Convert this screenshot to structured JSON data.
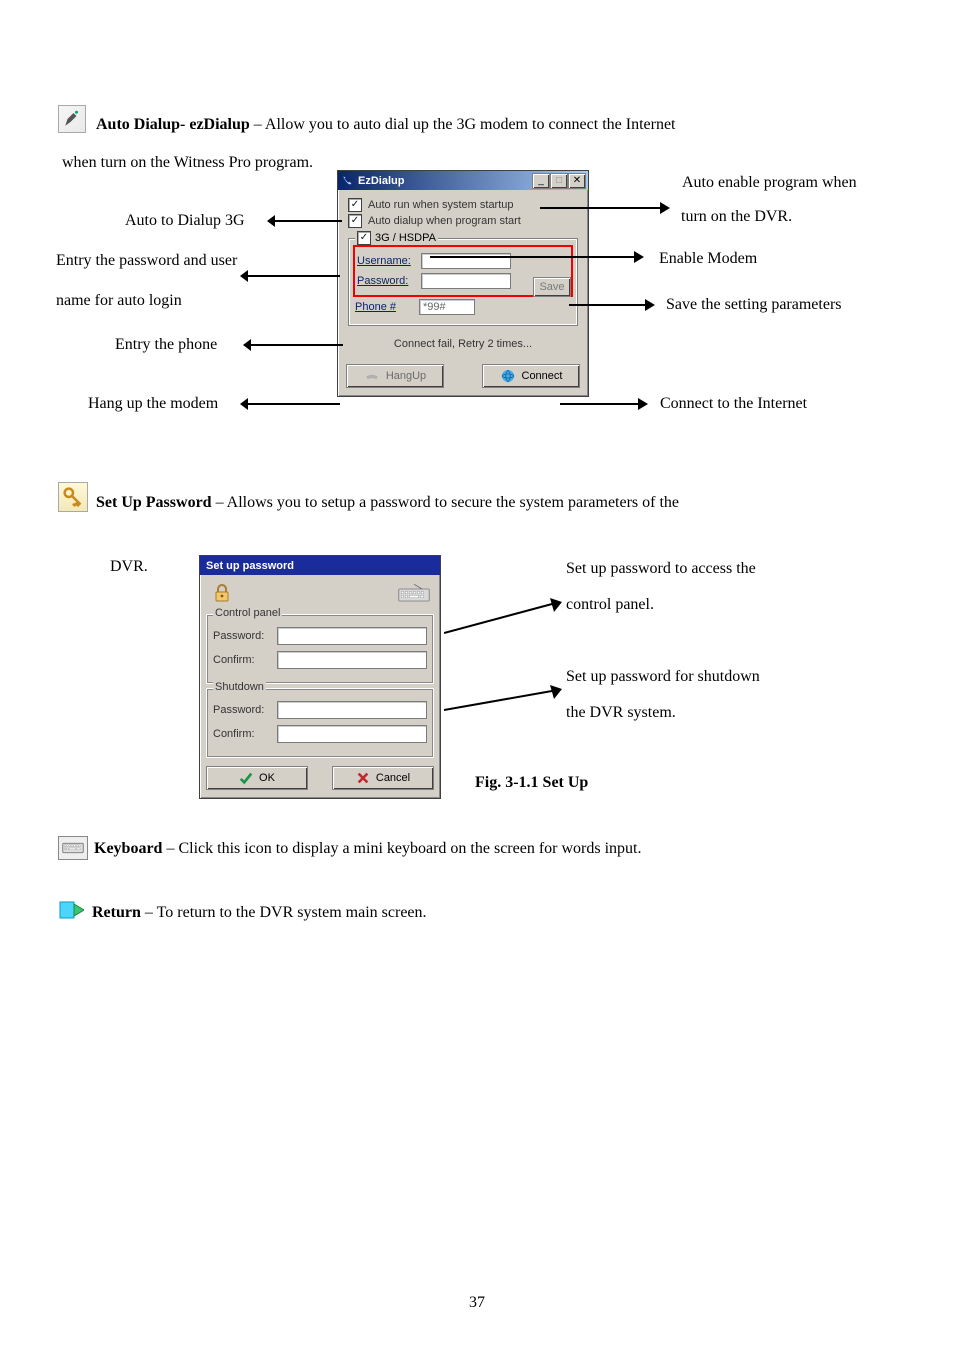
{
  "sections": {
    "auto_dialup": {
      "title": "Auto Dialup- ezDialup",
      "desc1": "– Allow you to auto dial up the 3G modem to connect the Internet",
      "desc2": "when turn on the Witness Pro program."
    },
    "set_up_password": {
      "title": "Set Up Password",
      "desc": "– Allows you to setup a password to secure the system parameters of the",
      "dvr_label": "DVR."
    },
    "keyboard": {
      "title": "Keyboard",
      "desc": "– Click this icon to display a mini keyboard on the screen for words input."
    },
    "return": {
      "title": "Return",
      "desc": "– To return to the DVR system main screen."
    }
  },
  "callouts": {
    "auto_enable": "Auto enable program when",
    "turn_on_dvr": "turn on the DVR.",
    "auto_to_dialup": "Auto to Dialup 3G",
    "entry_pw_user": "Entry the password and user",
    "name_auto_login": "name for auto login",
    "enable_modem": "Enable Modem",
    "save_params": "Save the setting parameters",
    "entry_phone": "Entry the phone",
    "hangup_modem": "Hang up the modem",
    "connect_internet": "Connect to the Internet",
    "setup_pw_access": "Set up password to access the",
    "control_panel": "control panel.",
    "setup_pw_shutdown": "Set up password for shutdown",
    "the_dvr_system": "the DVR system.",
    "fig_caption": "Fig. 3-1.1 Set Up"
  },
  "ezdialup": {
    "title": "EzDialup",
    "chk_auto_run": "Auto run when system startup",
    "chk_auto_dial": "Auto dialup when program start",
    "group_label": "3G / HSDPA",
    "username_label": "Username:",
    "username_value": "",
    "password_label": "Password:",
    "password_value": "",
    "phone_label": "Phone #",
    "phone_value": "*99#",
    "save_label": "Save",
    "status": "Connect fail, Retry 2 times...",
    "hangup_label": "HangUp",
    "connect_label": "Connect"
  },
  "pwwin": {
    "title": "Set up password",
    "control_legend": "Control panel",
    "shutdown_legend": "Shutdown",
    "password_label": "Password:",
    "confirm_label": "Confirm:",
    "ok_label": "OK",
    "cancel_label": "Cancel"
  },
  "page_number": "37"
}
